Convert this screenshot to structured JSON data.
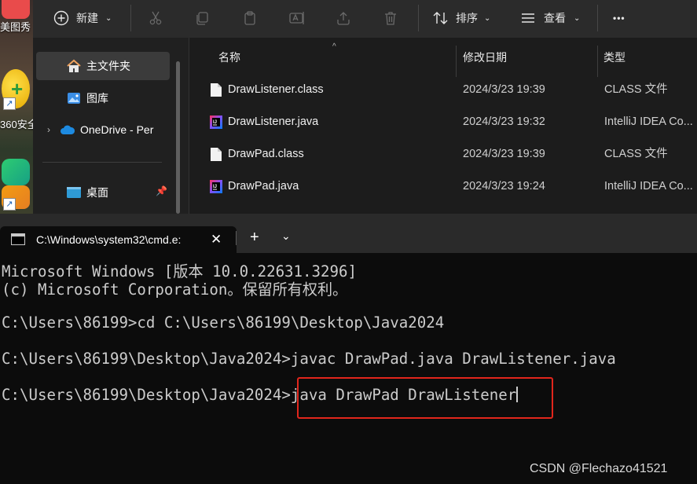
{
  "desktop": {
    "items": [
      {
        "label": "美图秀"
      },
      {
        "label": "360安全"
      }
    ]
  },
  "explorer": {
    "toolbar": {
      "new_label": "新建",
      "sort_label": "排序",
      "view_label": "查看",
      "more_label": "•••"
    },
    "nav": {
      "items": [
        {
          "label": "主文件夹",
          "icon": "home-icon"
        },
        {
          "label": "图库",
          "icon": "gallery-icon"
        },
        {
          "label": "OneDrive - Per",
          "icon": "cloud-icon"
        },
        {
          "label": "桌面",
          "icon": "desktop-icon"
        }
      ]
    },
    "columns": {
      "name": "名称",
      "modified": "修改日期",
      "type": "类型"
    },
    "files": [
      {
        "name": "DrawListener.class",
        "modified": "2024/3/23 19:39",
        "type": "CLASS 文件",
        "icon": "file-icon"
      },
      {
        "name": "DrawListener.java",
        "modified": "2024/3/23 19:32",
        "type": "IntelliJ IDEA Co...",
        "icon": "intellij-icon"
      },
      {
        "name": "DrawPad.class",
        "modified": "2024/3/23 19:39",
        "type": "CLASS 文件",
        "icon": "file-icon"
      },
      {
        "name": "DrawPad.java",
        "modified": "2024/3/23 19:24",
        "type": "IntelliJ IDEA Co...",
        "icon": "intellij-icon"
      }
    ]
  },
  "terminal": {
    "tab_title": "C:\\Windows\\system32\\cmd.e:",
    "close_glyph": "✕",
    "newtab_glyph": "+",
    "dropdown_glyph": "⌄",
    "lines": [
      "Microsoft Windows [版本 10.0.22631.3296]",
      "(c) Microsoft Corporation。保留所有权利。",
      "",
      "C:\\Users\\86199>cd C:\\Users\\86199\\Desktop\\Java2024",
      "",
      "C:\\Users\\86199\\Desktop\\Java2024>javac DrawPad.java DrawListener.java",
      ""
    ],
    "prompt": "C:\\Users\\86199\\Desktop\\Java2024>",
    "command": "java DrawPad DrawListener",
    "highlight_color": "#e1261c"
  },
  "watermark": "CSDN @Flechazo41521"
}
